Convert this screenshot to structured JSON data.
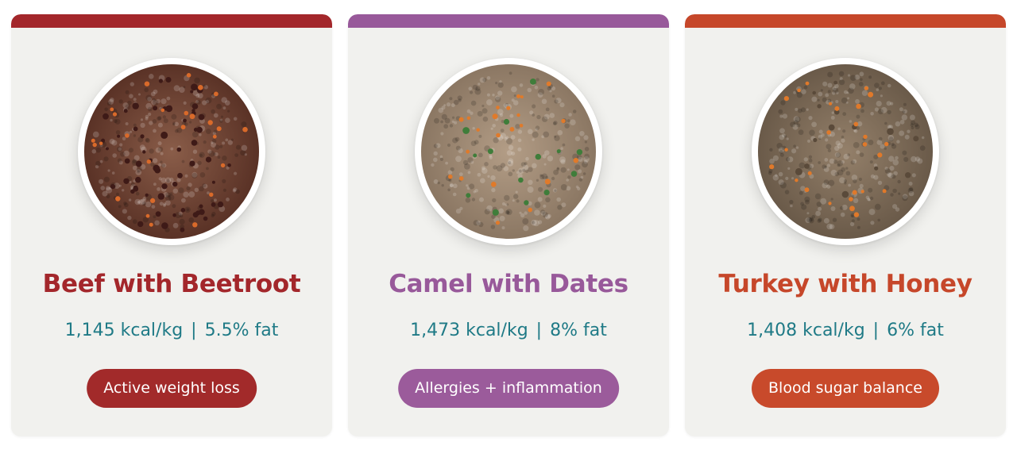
{
  "products": [
    {
      "name": "Beef with Beetroot",
      "kcal": "1,145 kcal/kg",
      "fat": "5.5% fat",
      "tag": "Active weight loss",
      "colors": {
        "accent": "#a3272b",
        "tag_bg": "#a22a2a",
        "food": "#8a5d49",
        "food_dark": "#5a3226",
        "speck": "#3e1a17",
        "veg": "#d96a2a"
      },
      "image_icon": "bowl-of-beef-food-icon"
    },
    {
      "name": "Camel with Dates",
      "kcal": "1,473 kcal/kg",
      "fat": "8% fat",
      "tag": "Allergies + inflammation",
      "colors": {
        "accent": "#98599a",
        "tag_bg": "#9b5b9b",
        "food": "#b39d86",
        "food_dark": "#8b7763",
        "speck": "#3f7d3a",
        "veg": "#e07a2a"
      },
      "image_icon": "bowl-of-camel-food-icon"
    },
    {
      "name": "Turkey with Honey",
      "kcal": "1,408 kcal/kg",
      "fat": "6% fat",
      "tag": "Blood sugar balance",
      "colors": {
        "accent": "#c6472a",
        "tag_bg": "#c84a2b",
        "food": "#94806a",
        "food_dark": "#6a5a49",
        "speck": "#5a4a3a",
        "veg": "#e0792a"
      },
      "image_icon": "bowl-of-turkey-food-icon"
    }
  ],
  "separator": "|"
}
